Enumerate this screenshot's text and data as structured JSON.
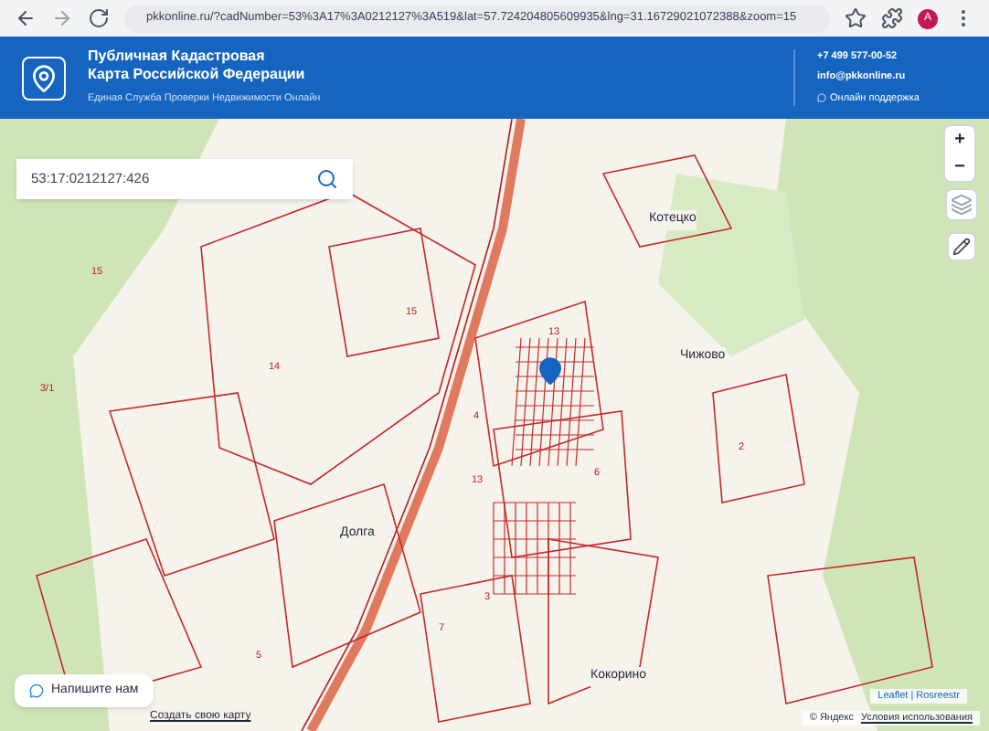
{
  "browser": {
    "url": "pkkonline.ru/?cadNumber=53%3A17%3A0212127%3A519&lat=57.724204805609935&lng=31.16729021072388&zoom=15",
    "profile": "А"
  },
  "header": {
    "title": "Публичная Кадастровая Карта Российской Федерации",
    "subtitle": "Единая Служба Проверки Недвижимости Онлайн",
    "phone": "+7 499 577-00-52",
    "email": "info@pkkonline.ru",
    "support": "Онлайн поддержка"
  },
  "search": {
    "value": "53:17:0212127:426"
  },
  "zoom_controls": [
    "+",
    "−"
  ],
  "map_labels": [
    {
      "kind": "place",
      "text": "Котецко"
    },
    {
      "kind": "place",
      "text": "Чижово"
    },
    {
      "kind": "place",
      "text": "Долга"
    },
    {
      "kind": "place",
      "text": "Кокорино"
    },
    {
      "kind": "parcel",
      "text": "15"
    },
    {
      "kind": "parcel",
      "text": "15"
    },
    {
      "kind": "parcel",
      "text": "13"
    },
    {
      "kind": "parcel",
      "text": "13"
    },
    {
      "kind": "parcel",
      "text": "14"
    },
    {
      "kind": "parcel",
      "text": "6"
    },
    {
      "kind": "parcel",
      "text": "2"
    },
    {
      "kind": "parcel",
      "text": "4"
    },
    {
      "kind": "parcel",
      "text": "3"
    },
    {
      "kind": "parcel",
      "text": "7"
    },
    {
      "kind": "parcel",
      "text": "5"
    },
    {
      "kind": "parcel",
      "text": "3/1"
    }
  ],
  "chat_button": "Напишите нам",
  "create_map_link": "Создать свою карту",
  "attribution": "Leaflet | Rosreestr",
  "yandex": {
    "copyright": "© Яндекс",
    "terms": "Условия использования"
  }
}
